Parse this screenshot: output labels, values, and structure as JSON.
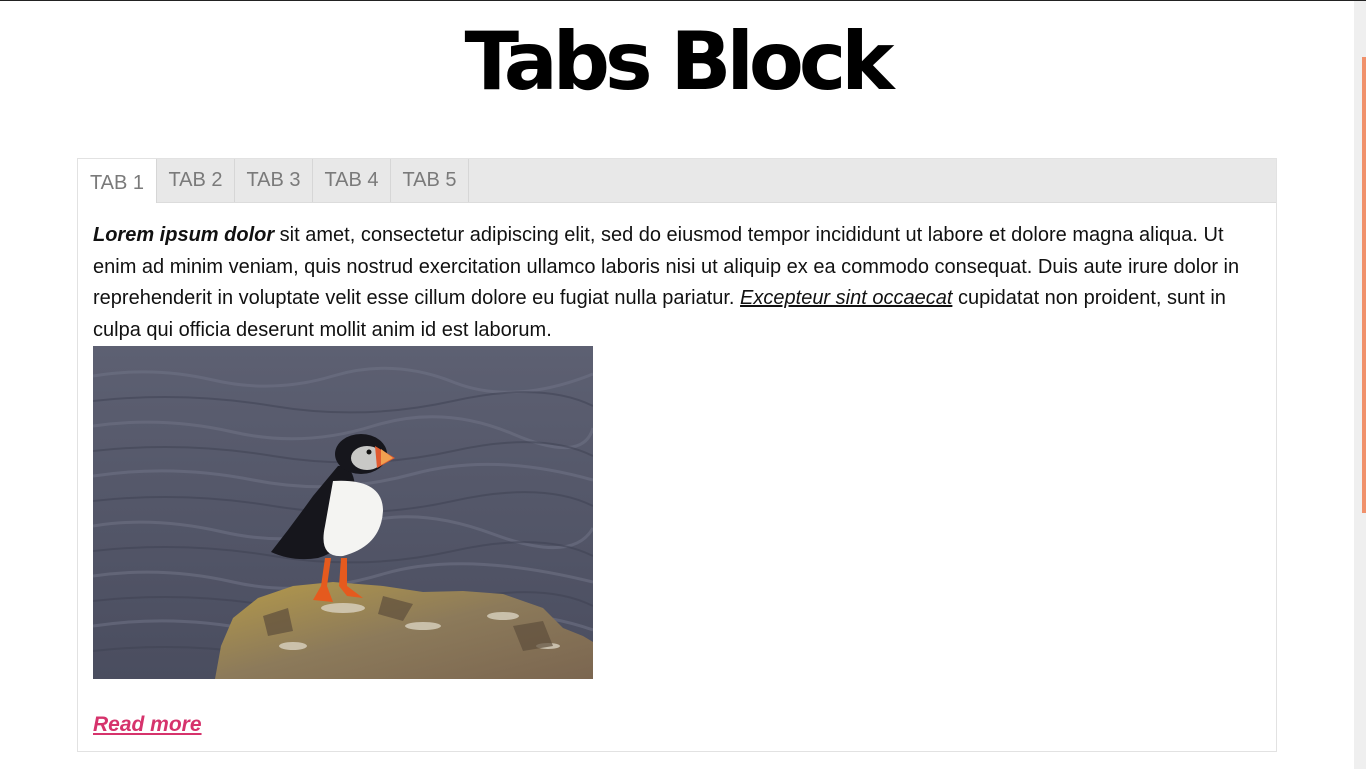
{
  "page": {
    "title": "Tabs Block"
  },
  "tabs": [
    {
      "label": "TAB 1",
      "active": true
    },
    {
      "label": "TAB 2",
      "active": false
    },
    {
      "label": "TAB 3",
      "active": false
    },
    {
      "label": "TAB 4",
      "active": false
    },
    {
      "label": "TAB 5",
      "active": false
    }
  ],
  "panel": {
    "lead": "Lorem ipsum dolor",
    "text_1": " sit amet, consectetur adipiscing elit, sed do eiusmod tempor incididunt ut labore et dolore magna aliqua. Ut enim ad minim veniam, quis nostrud exercitation ullamco laboris nisi ut aliquip ex ea commodo consequat. Duis aute irure dolor in reprehenderit in voluptate velit esse cillum dolore eu fugiat nulla pariatur. ",
    "link_text": "Excepteur sint occaecat",
    "text_2": " cupidatat non proident, sunt in culpa qui officia deserunt mollit anim id est laborum.",
    "image_subject": "puffin-on-rock",
    "read_more": "Read more"
  },
  "colors": {
    "accent": "#d6336c",
    "scroll_thumb": "#f0916b",
    "tab_bar": "#e8e8e8"
  }
}
